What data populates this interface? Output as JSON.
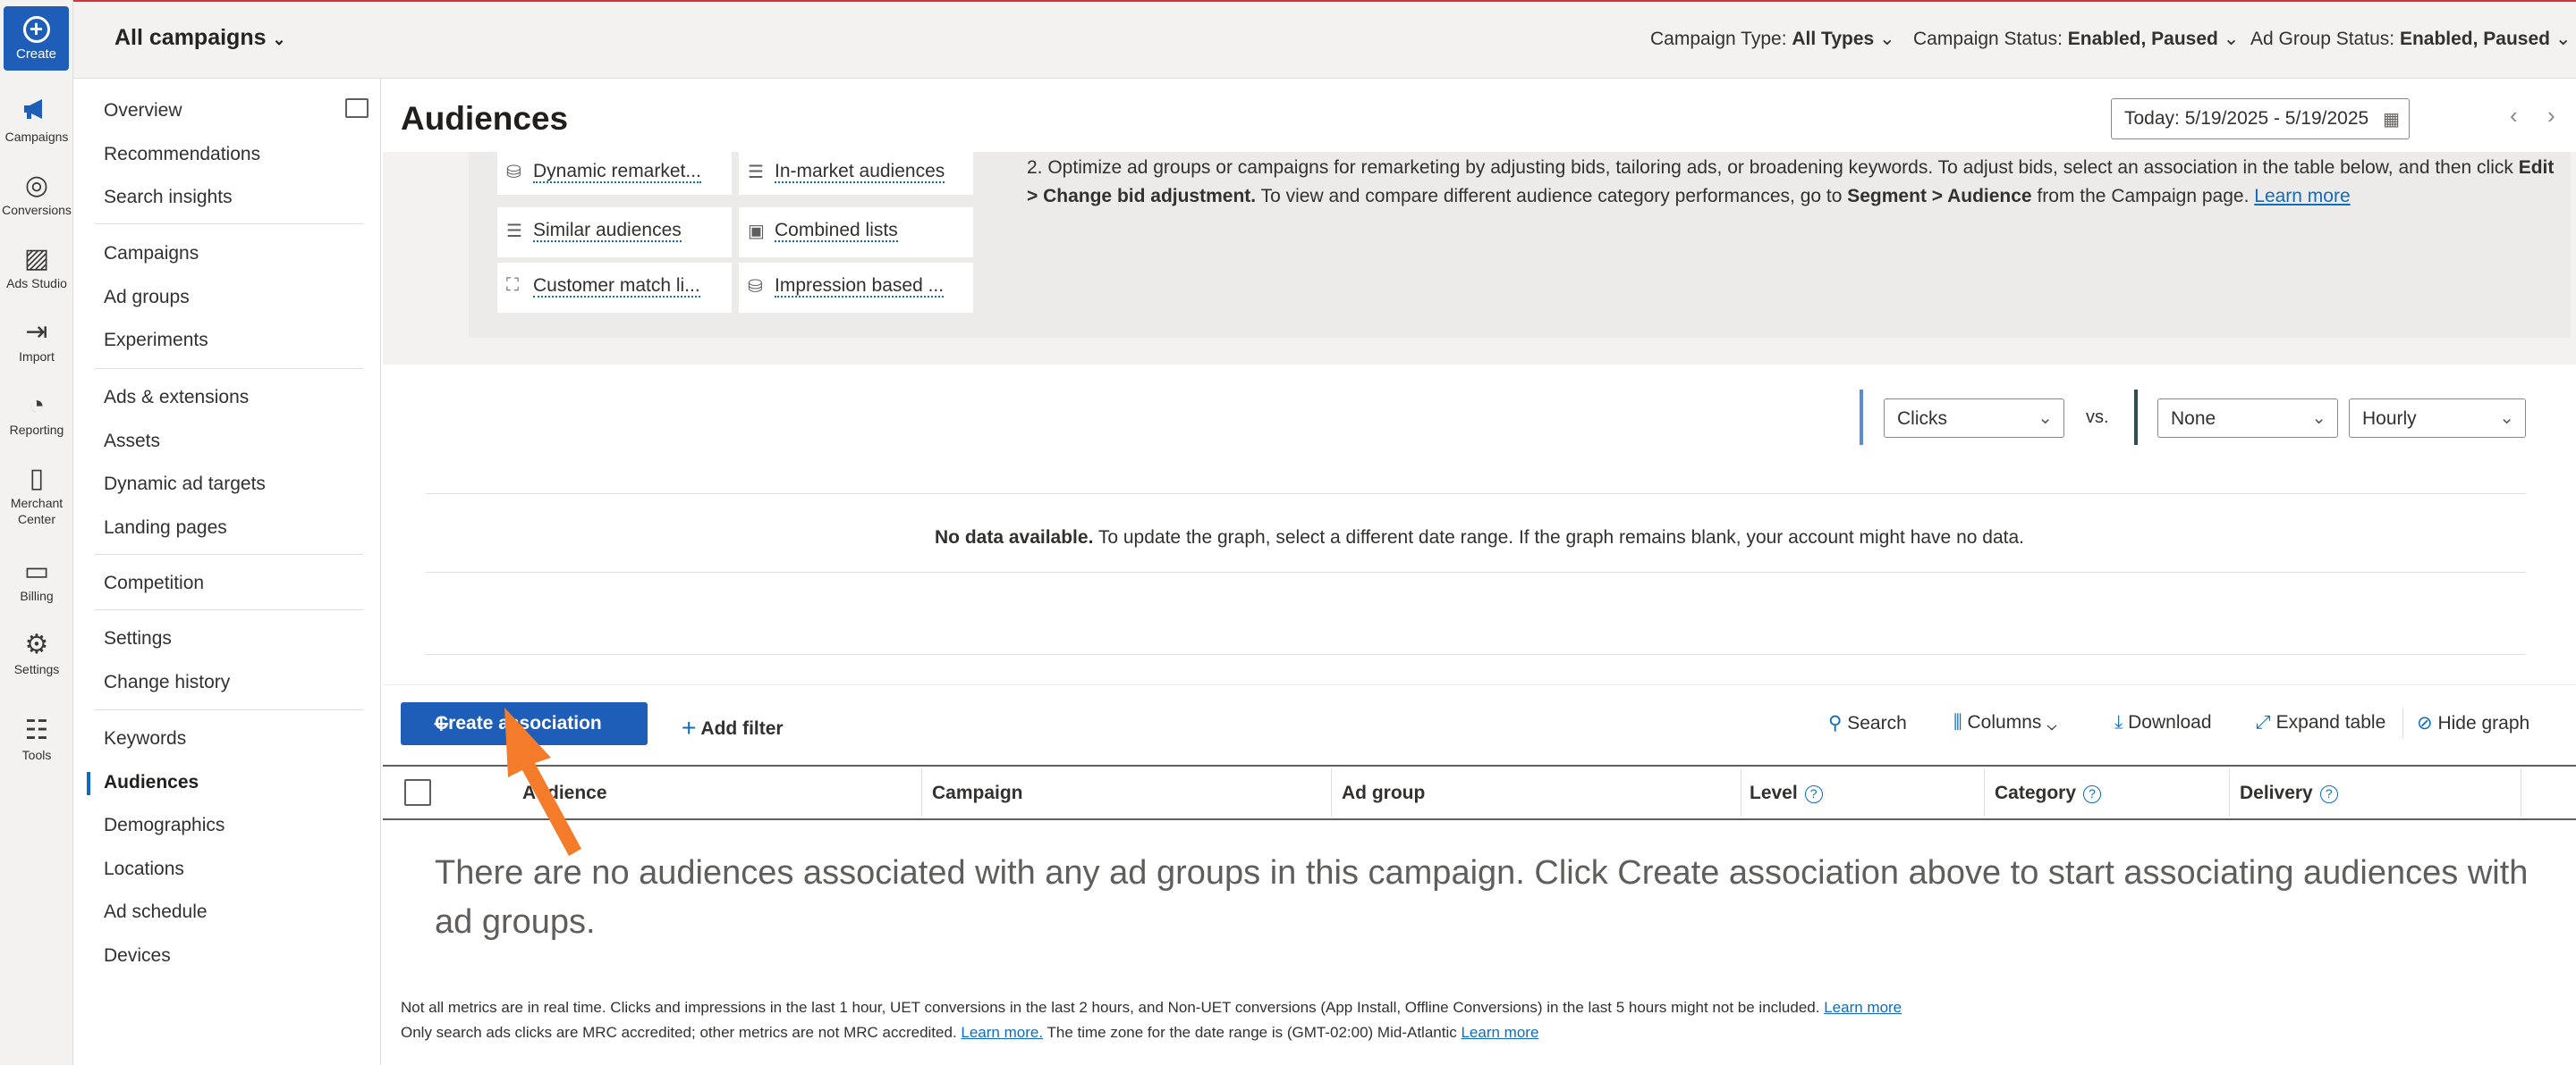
{
  "rail": {
    "create_label": "Create",
    "items": [
      {
        "label": "Campaigns",
        "icon": "megaphone-icon"
      },
      {
        "label": "Conversions",
        "icon": "target-icon"
      },
      {
        "label": "Ads Studio",
        "icon": "image-edit-icon"
      },
      {
        "label": "Import",
        "icon": "import-icon"
      },
      {
        "label": "Reporting",
        "icon": "report-icon"
      },
      {
        "label": "Merchant Center",
        "icon": "shopping-bag-icon"
      },
      {
        "label": "Billing",
        "icon": "wallet-icon"
      },
      {
        "label": "Settings",
        "icon": "gear-icon"
      },
      {
        "label": "Tools",
        "icon": "tools-icon"
      }
    ]
  },
  "topbar": {
    "scope": "All campaigns",
    "filters": [
      {
        "label": "Campaign Type:",
        "value": "All Types"
      },
      {
        "label": "Campaign Status:",
        "value": "Enabled, Paused"
      },
      {
        "label": "Ad Group Status:",
        "value": "Enabled, Paused"
      }
    ]
  },
  "nav": {
    "items": [
      "Overview",
      "Recommendations",
      "Search insights",
      "Campaigns",
      "Ad groups",
      "Experiments",
      "Ads & extensions",
      "Assets",
      "Dynamic ad targets",
      "Landing pages",
      "Competition",
      "Settings",
      "Change history",
      "Keywords",
      "Audiences",
      "Demographics",
      "Locations",
      "Ad schedule",
      "Devices"
    ],
    "active": "Audiences"
  },
  "page": {
    "title": "Audiences",
    "date_range": "Today: 5/19/2025 - 5/19/2025"
  },
  "audience_tiles": [
    "Dynamic remarket...",
    "In-market audiences",
    "Similar audiences",
    "Combined lists",
    "Customer match li...",
    "Impression based ..."
  ],
  "instructions": {
    "prefix": "2. Optimize ad groups or campaigns for remarketing by adjusting bids, tailoring ads, or broadening keywords. To adjust bids, select an association in the table below, and then click ",
    "bold1": "Edit > Change bid adjustment.",
    "mid": " To view and compare different audience category performances, go to ",
    "bold2": "Segment > Audience",
    "suffix": " from the Campaign page. ",
    "link": "Learn more"
  },
  "graph": {
    "metric1": "Clicks",
    "vs": "vs.",
    "metric2": "None",
    "granularity": "Hourly",
    "no_data_bold": "No data available.",
    "no_data_text": " To update the graph, select a different date range. If the graph remains blank, your account might have no data."
  },
  "toolbar": {
    "create_association": "Create association",
    "add_filter": "Add filter",
    "search": "Search",
    "columns": "Columns",
    "download": "Download",
    "expand_table": "Expand table",
    "hide_graph": "Hide graph"
  },
  "table": {
    "columns": [
      "Audience",
      "Campaign",
      "Ad group",
      "Level",
      "Category",
      "Delivery"
    ],
    "empty_message": "There are no audiences associated with any ad groups in this campaign. Click Create association above to start associating audiences with ad groups."
  },
  "footer": {
    "line1": "Not all metrics are in real time. Clicks and impressions in the last 1 hour, UET conversions in the last 2 hours, and Non-UET conversions (App Install, Offline Conversions) in the last 5 hours might not be included. ",
    "line1_link": "Learn more",
    "line2a": "Only search ads clicks are MRC accredited; other metrics are not MRC accredited. ",
    "line2_link1": "Learn more.",
    "line2b": " The time zone for the date range is (GMT-02:00) Mid-Atlantic ",
    "line2_link2": "Learn more"
  },
  "colors": {
    "primary": "#1F5EB8",
    "link": "#0F6CBD",
    "annotation_arrow": "#F47B2A"
  }
}
